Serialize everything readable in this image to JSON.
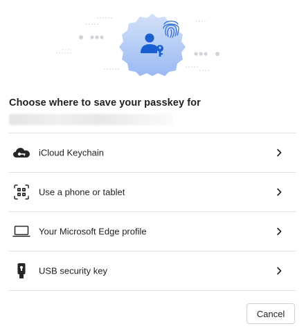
{
  "dialog": {
    "heading": "Choose where to save your passkey for",
    "site_redacted": true
  },
  "hero": {
    "badge_icon": "person-key-icon",
    "accent_icon": "fingerprint-icon",
    "badge_gradient": [
      "#c7d8f7",
      "#9ab9f2"
    ],
    "accent_color": "#2e6bd6"
  },
  "options": [
    {
      "label": "iCloud Keychain",
      "icon": "cloud-key-icon"
    },
    {
      "label": "Use a phone or tablet",
      "icon": "qr-code-icon"
    },
    {
      "label": "Your Microsoft Edge profile",
      "icon": "laptop-icon"
    },
    {
      "label": "USB security key",
      "icon": "usb-key-icon"
    }
  ],
  "footer": {
    "cancel_label": "Cancel"
  }
}
